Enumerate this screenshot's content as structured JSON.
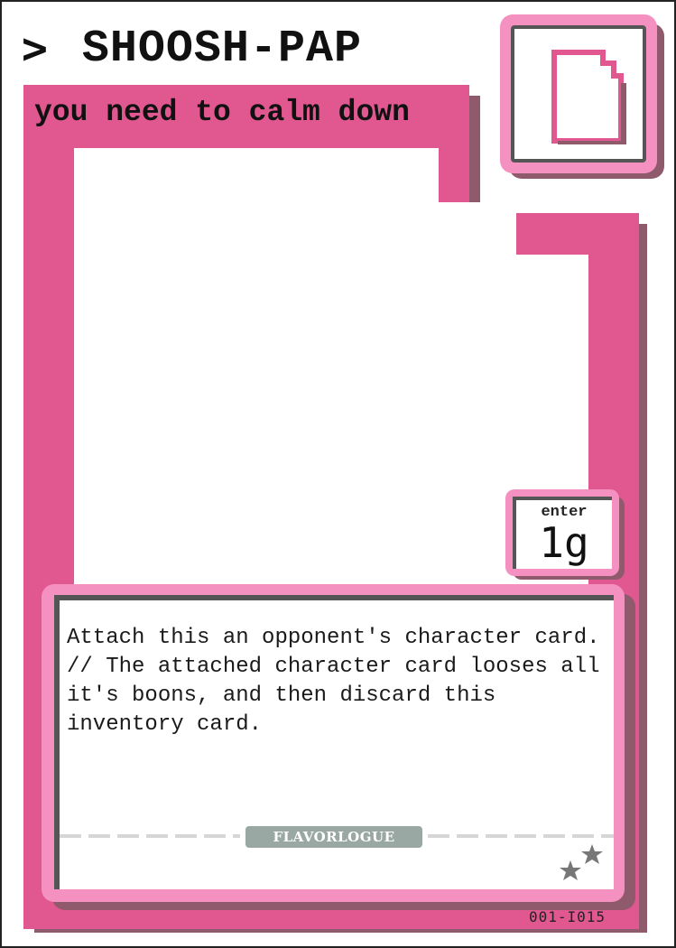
{
  "card": {
    "prompt_symbol": ">",
    "name": "SHOOSH-PAP",
    "subtitle": "you need to calm down",
    "type_icon": "document-icon",
    "cost": {
      "label": "enter",
      "value": "1g"
    },
    "rules_text": "Attach this an opponent's character card. // The attached character card looses all it's boons, and then discard this inventory card.",
    "flavor_label": "FLAVORLOGUE",
    "rarity_icon": "two-stars-icon",
    "card_number": "001-I015"
  },
  "colors": {
    "frame_pink": "#e0588f",
    "light_pink": "#f591c0",
    "shadow": "#8e5a6c",
    "flavor_badge": "#9aa8a4"
  }
}
